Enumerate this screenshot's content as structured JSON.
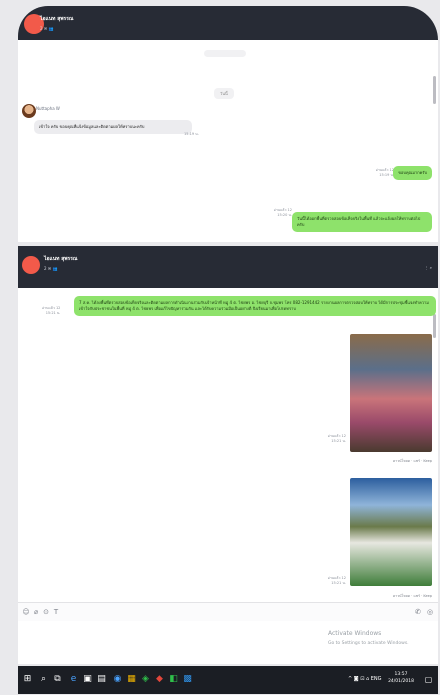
{
  "top_window": {
    "header": {
      "name": "ไอแนท สุพรรณ",
      "meta": "2 ✉ 👥"
    },
    "date_pill": "",
    "date_pill_2": "วันนี้",
    "incoming": {
      "sender": "Nuttapha W",
      "text": "เข้าใจ ครับ ขอบคุณที่แจ้งข้อมูลและติดตามผลให้ทราบนะครับ",
      "time": "15:19 น."
    },
    "outgoing_1": {
      "meta_read": "อ่านแล้ว 12",
      "meta_time": "15:19 น.",
      "text": "ขอบคุณมากครับ"
    },
    "outgoing_2": {
      "meta_read": "อ่านแล้ว 12",
      "meta_time": "15:20 น.",
      "text": "วันนี้ได้ออกพื้นที่ตรวจสอบข้อเท็จจริงในพื้นที่ แล้วจะแจ้งผลให้ทราบต่อไปครับ"
    }
  },
  "bottom_window": {
    "header": {
      "name": "ไอแนท สุพรรณ",
      "meta": "2 ✉ 👥",
      "right": "⋮ ⌕"
    },
    "long_message": {
      "meta_read": "อ่านแล้ว 12",
      "meta_time": "15:21 น.",
      "text": "7 ส.ค. ได้ลงพื้นที่ตรวจสอบข้อเท็จจริงและติดตามผลการดำเนินงานร่วมกับเจ้าหน้าที่ หมู่ 4 ต. ไชยพร อ. ไชยบุรี จ.ชุมพร โทร 082-1291442 รายงานผลการตรวจสอบให้ทราบ ได้มีการประชุมชี้แจงทำความเข้าใจกับประชาชนในพื้นที่ หมู่ 4 ต. ไชยพร เพื่อแก้ไขปัญหาร่วมกัน และได้รับความร่วมมือเป็นอย่างดี จึงเรียนมาเพื่อโปรดทราบ"
    },
    "photo_1": {
      "meta_read": "อ่านแล้ว 12",
      "meta_time": "15:21 น.",
      "caption": "ดาวน์โหลด · แชร์ · Keep"
    },
    "photo_2": {
      "meta_read": "อ่านแล้ว 12",
      "meta_time": "15:21 น.",
      "caption": "ดาวน์โหลด · แชร์ · Keep"
    },
    "composer_icons": {
      "left": [
        "☺",
        "⌀",
        "⊙",
        "T"
      ],
      "right": [
        "✆",
        "◎"
      ]
    },
    "activation": {
      "title": "Activate Windows",
      "subtitle": "Go to Settings to activate Windows."
    }
  },
  "taskbar": {
    "apps": [
      "⊞",
      "⌕",
      "⧉",
      "e",
      "▣",
      "▤",
      "◉",
      "▦",
      "◈",
      "◆",
      "◧",
      "▩"
    ],
    "tray": "^ ◙ ⊡ ⌂ ENG",
    "time": "13:57",
    "date": "24/01/2018"
  },
  "colors": {
    "header": "#272b35",
    "outgoing": "#8ee26b",
    "incoming": "#ececef",
    "avatar": "#f25a4a",
    "taskbar": "#1b1e24"
  }
}
